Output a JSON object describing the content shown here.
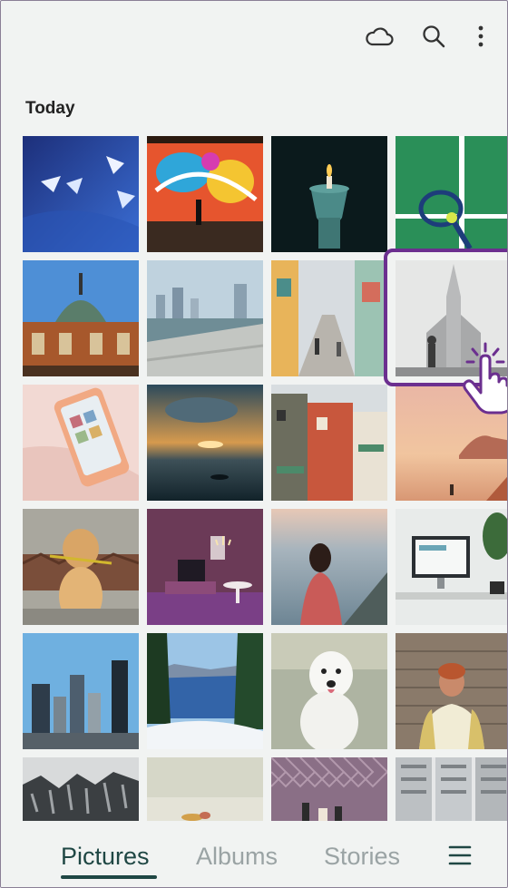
{
  "toolbar": {
    "icons": [
      "cloud-icon",
      "search-icon",
      "more-vert-icon"
    ]
  },
  "section": {
    "title": "Today"
  },
  "photos": [
    "paper-boats",
    "graffiti-wall",
    "candle-lantern",
    "tennis-racket",
    "station-building",
    "city-river-steps",
    "colorful-street",
    "church-tower",
    "phone-in-hand",
    "sunset-sea",
    "old-houses",
    "desert-rocks",
    "golden-dog",
    "purple-room",
    "woman-at-sea",
    "desk-computer",
    "skyscrapers",
    "lake-pines",
    "white-dog",
    "smiling-person",
    "crowd-aerial",
    "table-dinner",
    "fence-bottles",
    "apartment-blocks"
  ],
  "bottom_nav": {
    "tabs": [
      "Pictures",
      "Albums",
      "Stories"
    ],
    "active": "Pictures",
    "menu_icon": "hamburger-menu-icon"
  },
  "colors": {
    "accent": "#1f4744",
    "highlight": "#6b2f8f",
    "background": "#f1f3f2",
    "inactive_tab": "#9aa3a4"
  }
}
